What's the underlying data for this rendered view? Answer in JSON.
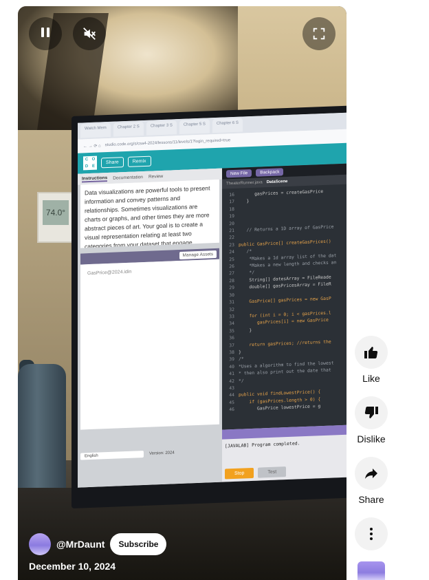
{
  "player": {
    "pause_icon": "pause-icon",
    "mute_icon": "volume-muted-icon",
    "fullscreen_icon": "fullscreen-icon"
  },
  "video_content": {
    "thermostat_reading": "74.0°",
    "browser_tabs": [
      "Watch Mem",
      "Chapter 2 S",
      "Chapter 3 S",
      "Chapter 5 S",
      "Chapter 6 S"
    ],
    "url": "studio.code.org/s/csa4-2024/lessons/11/levels/1?login_required=true",
    "header_buttons": [
      "Share",
      "Remix"
    ],
    "instruction_tabs": [
      "Instructions",
      "Documentation",
      "Review"
    ],
    "instruction_text": "Data visualizations are powerful tools to present information and convey patterns and relationships. Sometimes visualizations are charts or graphs, and other times they are more abstract pieces of art. Your goal is to create a visual representation relating at least two categories from your dataset that engage",
    "manage_assets": "Manage Assets",
    "asset_file": "GasPrice@2024.idin",
    "language": "English",
    "version": "Version: 2024",
    "editor_buttons": [
      "New File",
      "Backpack"
    ],
    "file_tabs": [
      "TheaterRunner.java",
      "DataScene"
    ],
    "code_lines": [
      {
        "n": "16",
        "t": "      gasPrices = createGasPrice"
      },
      {
        "n": "17",
        "t": "   }"
      },
      {
        "n": "18",
        "t": ""
      },
      {
        "n": "19",
        "t": ""
      },
      {
        "n": "20",
        "t": ""
      },
      {
        "n": "21",
        "t": "   // Returns a 1D array of GasPrice"
      },
      {
        "n": "22",
        "t": ""
      },
      {
        "n": "23",
        "t": "public GasPrice[] createGasPrices()"
      },
      {
        "n": "24",
        "t": "   /*"
      },
      {
        "n": "25",
        "t": "    *Makes a 1d array list of the dat"
      },
      {
        "n": "26",
        "t": "    *Makes a new length and checks an"
      },
      {
        "n": "27",
        "t": "    */"
      },
      {
        "n": "28",
        "t": "    String[] datesArray = FileReade"
      },
      {
        "n": "29",
        "t": "    double[] gasPricesArray = FileR"
      },
      {
        "n": "30",
        "t": ""
      },
      {
        "n": "31",
        "t": "    GasPrice[] gasPrices = new GasP"
      },
      {
        "n": "32",
        "t": ""
      },
      {
        "n": "33",
        "t": "    for (int i = 0; i < gasPrices.l"
      },
      {
        "n": "34",
        "t": "       gasPrices[i] = new GasPrice"
      },
      {
        "n": "35",
        "t": "    }"
      },
      {
        "n": "36",
        "t": ""
      },
      {
        "n": "37",
        "t": "    return gasPrices; //returns the"
      },
      {
        "n": "38",
        "t": "}"
      },
      {
        "n": "39",
        "t": "/*"
      },
      {
        "n": "40",
        "t": "*Uses a algorithm to find the lowest"
      },
      {
        "n": "41",
        "t": "* then also print out the date that"
      },
      {
        "n": "42",
        "t": "*/"
      },
      {
        "n": "43",
        "t": ""
      },
      {
        "n": "44",
        "t": "public void findLowestPrice() {"
      },
      {
        "n": "45",
        "t": "    if (gasPrices.length > 0) {"
      },
      {
        "n": "46",
        "t": "       GasPrice lowestPrice = g"
      }
    ],
    "console_output": "[JAVALAB] Program completed.",
    "stop_label": "Stop",
    "test_label": "Test"
  },
  "channel": {
    "name": "@MrDaunt",
    "subscribe_label": "Subscribe",
    "date": "December 10, 2024"
  },
  "actions": {
    "like_label": "Like",
    "dislike_label": "Dislike",
    "share_label": "Share",
    "like_icon": "thumbs-up-icon",
    "dislike_icon": "thumbs-down-icon",
    "share_icon": "share-arrow-icon",
    "more_icon": "more-vertical-icon"
  }
}
